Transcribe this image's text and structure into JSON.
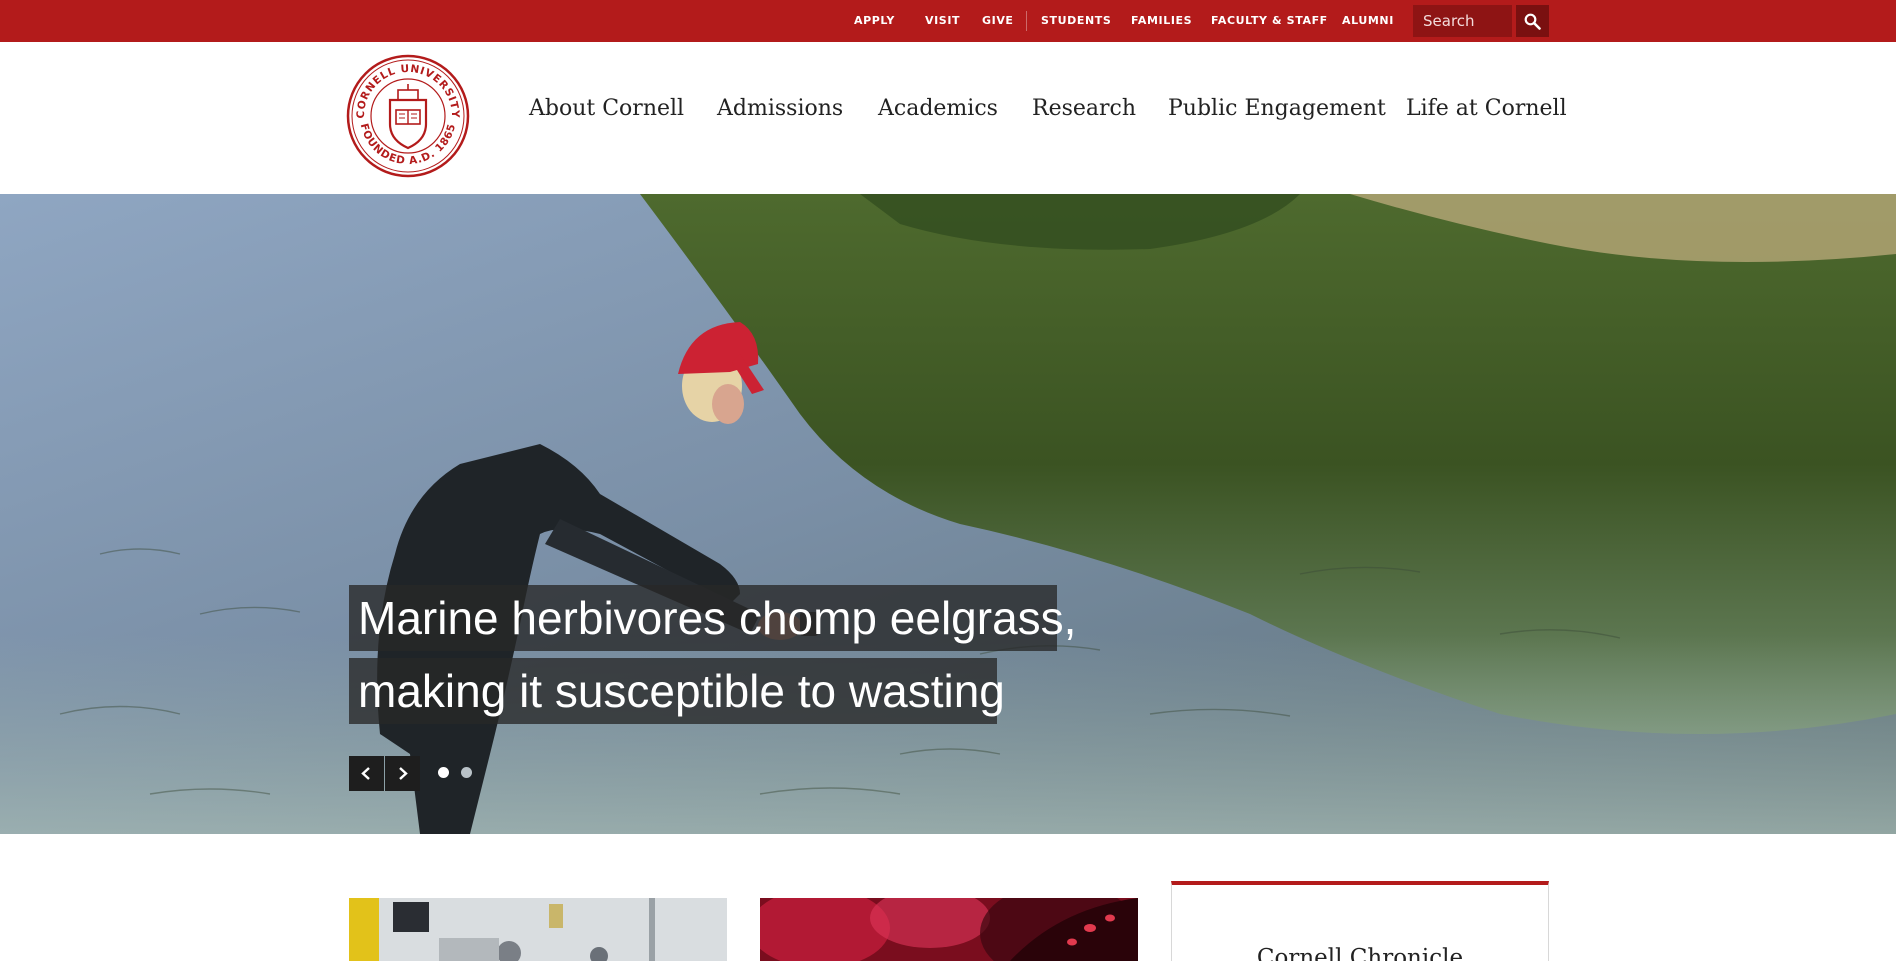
{
  "utility_nav": {
    "links": [
      {
        "label": "APPLY"
      },
      {
        "label": "VISIT"
      },
      {
        "label": "GIVE"
      },
      {
        "label": "STUDENTS"
      },
      {
        "label": "FAMILIES"
      },
      {
        "label": "FACULTY & STAFF"
      },
      {
        "label": "ALUMNI"
      }
    ],
    "search": {
      "placeholder": "Search",
      "button_icon": "search-icon"
    }
  },
  "header": {
    "logo": {
      "icon": "cornell-seal",
      "text_top": "CORNELL UNIVERSITY",
      "text_bottom": "FOUNDED A.D. 1865"
    },
    "nav": [
      {
        "label": "About Cornell"
      },
      {
        "label": "Admissions"
      },
      {
        "label": "Academics"
      },
      {
        "label": "Research"
      },
      {
        "label": "Public Engagement"
      },
      {
        "label": "Life at Cornell"
      }
    ]
  },
  "hero": {
    "caption_lines": [
      "Marine herbivores chomp eelgrass,",
      "making it susceptible to wasting"
    ],
    "controls": {
      "prev_icon": "chevron-left-icon",
      "next_icon": "chevron-right-icon"
    },
    "slide_count": 2,
    "active_slide": 1
  },
  "featured": {
    "chronicle_title": "Cornell Chronicle"
  },
  "colors": {
    "brand_red": "#b31b1b",
    "caption_bg": "#282828"
  }
}
